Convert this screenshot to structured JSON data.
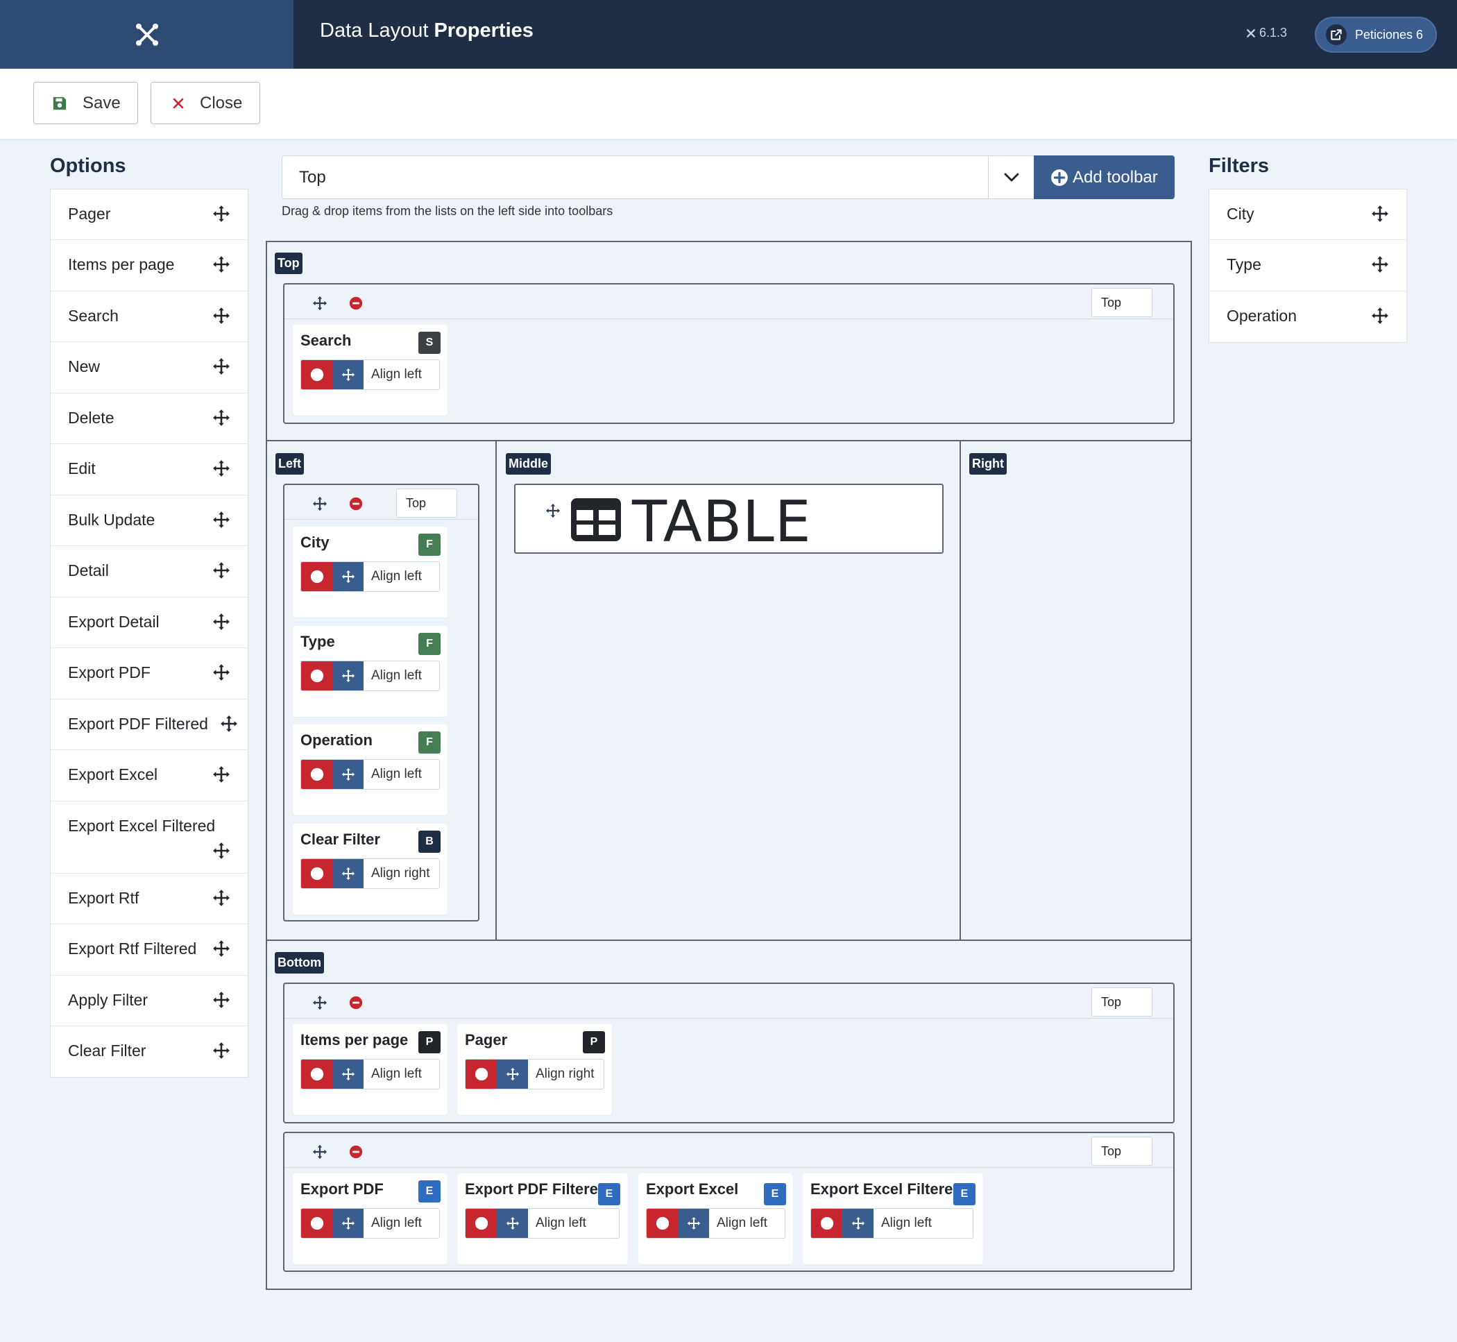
{
  "header": {
    "title_light": "Data Layout",
    "title_bold": "Properties",
    "version": "6.1.3",
    "peticiones_label": "Peticiones 6"
  },
  "toolbar": {
    "save_label": "Save",
    "close_label": "Close"
  },
  "options": {
    "title": "Options",
    "items": [
      "Pager",
      "Items per page",
      "Search",
      "New",
      "Delete",
      "Edit",
      "Bulk Update",
      "Detail",
      "Export Detail",
      "Export PDF",
      "Export PDF Filtered",
      "Export Excel",
      "Export Excel Filtered",
      "Export Rtf",
      "Export Rtf Filtered",
      "Apply Filter",
      "Clear Filter"
    ]
  },
  "filters": {
    "title": "Filters",
    "items": [
      "City",
      "Type",
      "Operation"
    ]
  },
  "selector": {
    "value": "Top",
    "add_label": "Add toolbar",
    "hint": "Drag & drop items from the lists on the left side into toolbars"
  },
  "areas": {
    "top": "Top",
    "left": "Left",
    "middle": "Middle",
    "right": "Right",
    "bottom": "Bottom"
  },
  "position_value": "Top",
  "table_label": "TABLE",
  "top_area": {
    "cards": [
      {
        "title": "Search",
        "badge": "S",
        "align": "Align left"
      }
    ]
  },
  "left_area": {
    "cards": [
      {
        "title": "City",
        "badge": "F",
        "align": "Align left"
      },
      {
        "title": "Type",
        "badge": "F",
        "align": "Align left"
      },
      {
        "title": "Operation",
        "badge": "F",
        "align": "Align left"
      },
      {
        "title": "Clear Filter",
        "badge": "B",
        "align": "Align right"
      }
    ]
  },
  "bottom_area": {
    "toolbar1": [
      {
        "title": "Items per page",
        "badge": "P",
        "align": "Align left"
      },
      {
        "title": "Pager",
        "badge": "P",
        "align": "Align right"
      }
    ],
    "toolbar2": [
      {
        "title": "Export PDF",
        "badge": "E",
        "align": "Align left"
      },
      {
        "title": "Export PDF Filtered",
        "badge": "E",
        "align": "Align left"
      },
      {
        "title": "Export Excel",
        "badge": "E",
        "align": "Align left"
      },
      {
        "title": "Export Excel Filtered",
        "badge": "E",
        "align": "Align left"
      }
    ]
  }
}
